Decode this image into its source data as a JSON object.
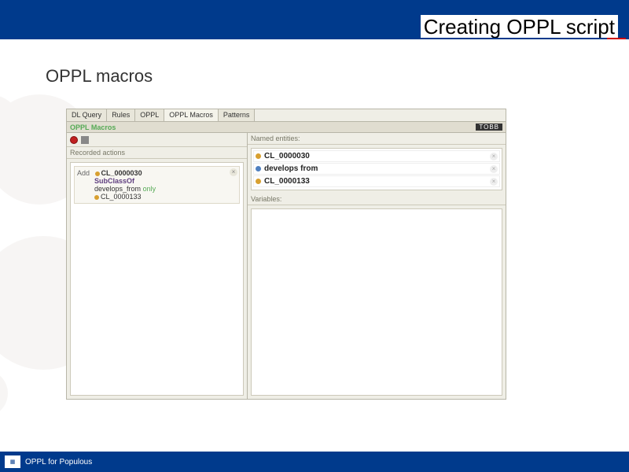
{
  "header": {
    "title": "Creating OPPL script"
  },
  "subtitle": "OPPL macros",
  "tabs": [
    "DL Query",
    "Rules",
    "OPPL",
    "OPPL Macros",
    "Patterns"
  ],
  "activeTab": 3,
  "subheader": {
    "left": "OPPL Macros",
    "right": "TOBB"
  },
  "sections": {
    "recorded_actions": "Recorded actions",
    "named_entities": "Named entities:",
    "variables": "Variables:"
  },
  "action": {
    "add": "Add",
    "e1": "CL_0000030",
    "subclass": "SubClassOf",
    "rel": "develops_from",
    "only": "only",
    "e2": "CL_0000133"
  },
  "entities": [
    {
      "color": "orange",
      "name": "CL_0000030"
    },
    {
      "color": "blue",
      "name": "develops from"
    },
    {
      "color": "orange",
      "name": "CL_0000133"
    }
  ],
  "footer": {
    "text": "OPPL for Populous"
  }
}
